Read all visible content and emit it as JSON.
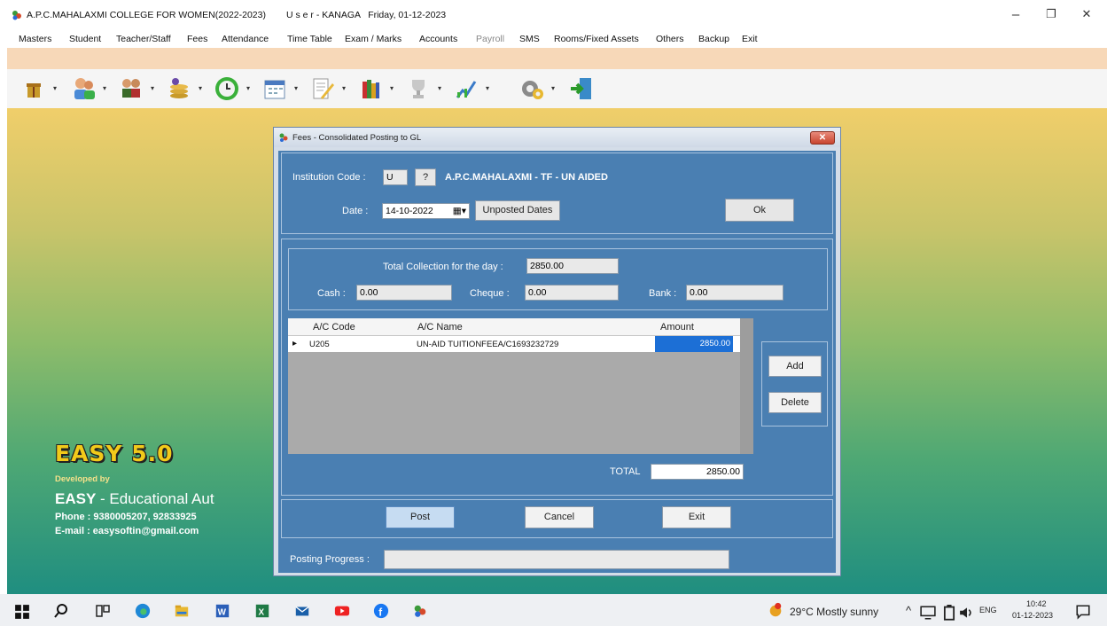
{
  "window": {
    "title": "A.P.C.MAHALAXMI COLLEGE FOR WOMEN(2022-2023)",
    "user_info": "U s e r - KANAGA   Friday, 01-12-2023",
    "minimize": "–",
    "restore": "❐",
    "close": "✕"
  },
  "menu": [
    {
      "label": "Masters"
    },
    {
      "label": "Student"
    },
    {
      "label": "Teacher/Staff"
    },
    {
      "label": "Fees"
    },
    {
      "label": "Attendance"
    },
    {
      "label": "Time Table"
    },
    {
      "label": "Exam / Marks"
    },
    {
      "label": "Accounts"
    },
    {
      "label": "Payroll"
    },
    {
      "label": "SMS"
    },
    {
      "label": "Rooms/Fixed Assets"
    },
    {
      "label": "Others"
    },
    {
      "label": "Backup"
    },
    {
      "label": "Exit"
    }
  ],
  "toolbar_icons": [
    "gift-icon",
    "staff-icon",
    "students-icon",
    "coins-icon",
    "clock-icon",
    "calendar-icon",
    "notepad-icon",
    "books-icon",
    "trophy-icon",
    "chart-icon",
    "settings-icon",
    "exit-door-icon"
  ],
  "branding": {
    "title": "EASY 5.0",
    "developed_by": "Developed by",
    "company_bold": "EASY",
    "company_rest": " - Educational Aut",
    "phone": "Phone : 9380005207, 92833925",
    "email": "E-mail : easysoftin@gmail.com"
  },
  "dialog": {
    "title": "Fees - Consolidated Posting to GL",
    "close_label": "✕",
    "institution_code_label": "Institution Code :",
    "institution_code_value": "U",
    "lookup_label": "?",
    "institution_name": "A.P.C.MAHALAXMI - TF - UN AIDED",
    "date_label": "Date :",
    "date_value": "14-10-2022",
    "date_picker": "▦▾",
    "unposted_label": "Unposted Dates",
    "ok_label": "Ok",
    "total_collection_label": "Total Collection for the day :",
    "total_collection_value": "2850.00",
    "cash_label": "Cash :",
    "cash_value": "0.00",
    "cheque_label": "Cheque :",
    "cheque_value": "0.00",
    "bank_label": "Bank :",
    "bank_value": "0.00",
    "grid": {
      "headers": [
        "A/C Code",
        "A/C Name",
        "Amount"
      ],
      "row_marker": "▸",
      "rows": [
        {
          "code": "U205",
          "name": "UN-AID TUITIONFEEA/C1693232729",
          "amount": "2850.00"
        }
      ]
    },
    "add_label": "Add",
    "delete_label": "Delete",
    "total_label": "TOTAL",
    "total_value": "2850.00",
    "post_label": "Post",
    "cancel_label": "Cancel",
    "exit_label": "Exit",
    "progress_label": "Posting Progress :",
    "progress_fraction": 0
  },
  "taskbar": {
    "weather": "29°C  Mostly sunny",
    "lang": "ENG",
    "time": "10:42",
    "date": "01-12-2023",
    "icons": [
      "start-icon",
      "search-icon",
      "task-view-icon",
      "edge-icon",
      "file-explorer-icon",
      "word-icon",
      "excel-icon",
      "mail-icon",
      "youtube-icon",
      "facebook-icon",
      "app-icon"
    ]
  }
}
